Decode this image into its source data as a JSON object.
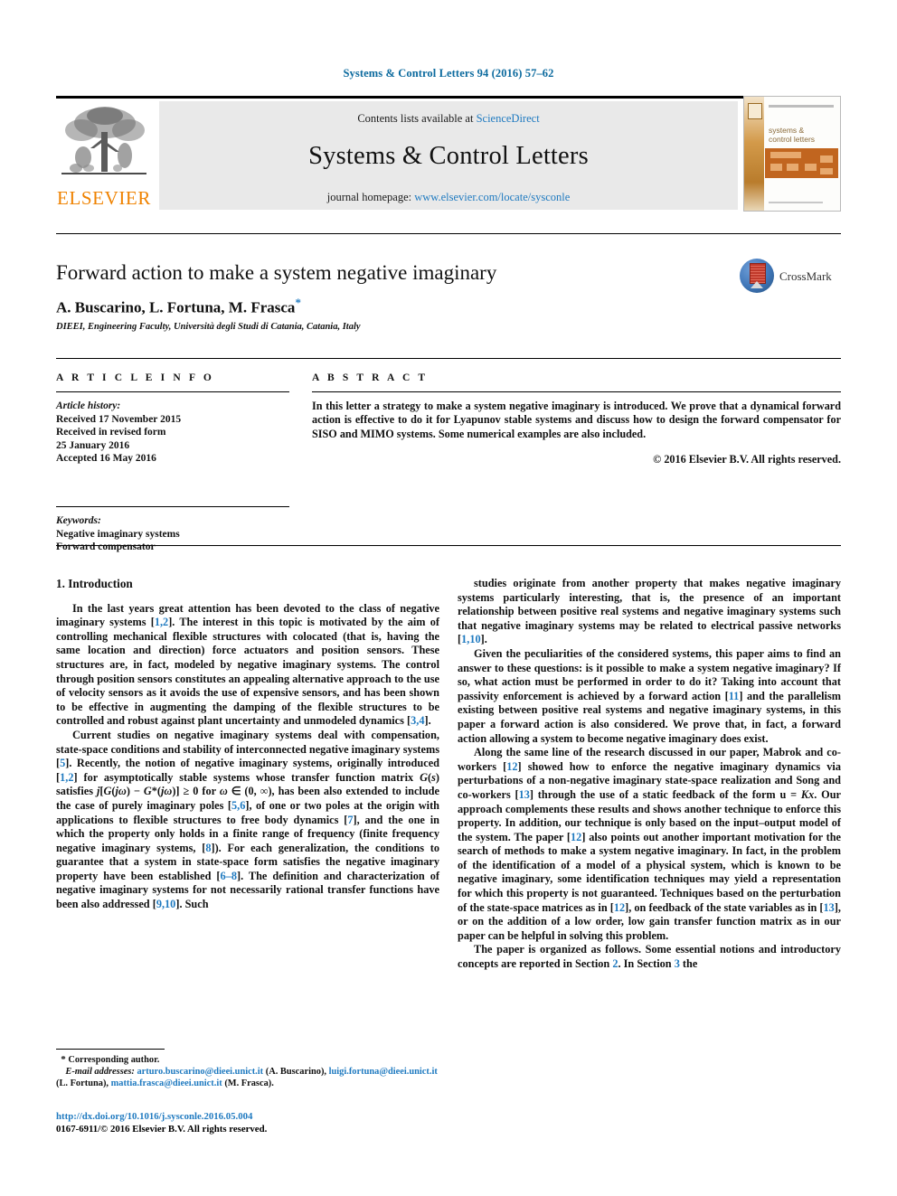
{
  "running_head": "Systems & Control Letters 94 (2016) 57–62",
  "masthead": {
    "contents_prefix": "Contents lists available at ",
    "sciencedirect": "ScienceDirect",
    "journal_title": "Systems & Control Letters",
    "homepage_prefix": "journal homepage: ",
    "homepage_url": "www.elsevier.com/locate/sysconle",
    "publisher_wordmark": "ELSEVIER",
    "cover_title_line1": "systems &",
    "cover_title_line2": "control letters"
  },
  "article": {
    "title": "Forward action to make a system negative imaginary",
    "authors": "A. Buscarino, L. Fortuna, M. Frasca",
    "corresponding_marker": "*",
    "affiliation": "DIEEI, Engineering Faculty, Università degli Studi di Catania, Catania, Italy"
  },
  "crossmark": {
    "label": "CrossMark"
  },
  "info": {
    "heading": "A R T I C L E   I N F O",
    "history_label": "Article history:",
    "history_lines": [
      "Received 17 November 2015",
      "Received in revised form",
      "25 January 2016",
      "Accepted 16 May 2016"
    ],
    "keywords_label": "Keywords:",
    "keywords": [
      "Negative imaginary systems",
      "Forward compensator"
    ]
  },
  "abstract": {
    "heading": "A B S T R A C T",
    "text": "In this letter a strategy to make a system negative imaginary is introduced. We prove that a dynamical forward action is effective to do it for Lyapunov stable systems and discuss how to design the forward compensator for SISO and MIMO systems. Some numerical examples are also included.",
    "copyright": "© 2016 Elsevier B.V. All rights reserved."
  },
  "body": {
    "section_title": "1. Introduction",
    "left_paragraphs": [
      "In the last years great attention has been devoted to the class of negative imaginary systems [1,2]. The interest in this topic is motivated by the aim of controlling mechanical flexible structures with colocated (that is, having the same location and direction) force actuators and position sensors. These structures are, in fact, modeled by negative imaginary systems. The control through position sensors constitutes an appealing alternative approach to the use of velocity sensors as it avoids the use of expensive sensors, and has been shown to be effective in augmenting the damping of the flexible structures to be controlled and robust against plant uncertainty and unmodeled dynamics [3,4].",
      "Current studies on negative imaginary systems deal with compensation, state-space conditions and stability of interconnected negative imaginary systems [5]. Recently, the notion of negative imaginary systems, originally introduced [1,2] for asymptotically stable systems whose transfer function matrix G(s) satisfies j[G(jω) − G*(jω)] ≥ 0 for ω ∈ (0, ∞), has been also extended to include the case of purely imaginary poles [5,6], of one or two poles at the origin with applications to flexible structures to free body dynamics [7], and the one in which the property only holds in a finite range of frequency (finite frequency negative imaginary systems, [8]). For each generalization, the conditions to guarantee that a system in state-space form satisfies the negative imaginary property have been established [6–8]. The definition and characterization of negative imaginary systems for not necessarily rational transfer functions have been also addressed [9,10]. Such"
    ],
    "right_paragraphs": [
      "studies originate from another property that makes negative imaginary systems particularly interesting, that is, the presence of an important relationship between positive real systems and negative imaginary systems such that negative imaginary systems may be related to electrical passive networks [1,10].",
      "Given the peculiarities of the considered systems, this paper aims to find an answer to these questions: is it possible to make a system negative imaginary? If so, what action must be performed in order to do it? Taking into account that passivity enforcement is achieved by a forward action [11] and the parallelism existing between positive real systems and negative imaginary systems, in this paper a forward action is also considered. We prove that, in fact, a forward action allowing a system to become negative imaginary does exist.",
      "Along the same line of the research discussed in our paper, Mabrok and co-workers [12] showed how to enforce the negative imaginary dynamics via perturbations of a non-negative imaginary state-space realization and Song and co-workers [13] through the use of a static feedback of the form u = Kx. Our approach complements these results and shows another technique to enforce this property. In addition, our technique is only based on the input–output model of the system. The paper [12] also points out another important motivation for the search of methods to make a system negative imaginary. In fact, in the problem of the identification of a model of a physical system, which is known to be negative imaginary, some identification techniques may yield a representation for which this property is not guaranteed. Techniques based on the perturbation of the state-space matrices as in [12], on feedback of the state variables as in [13], or on the addition of a low order, low gain transfer function matrix as in our paper can be helpful in solving this problem.",
      "The paper is organized as follows. Some essential notions and introductory concepts are reported in Section 2. In Section 3 the"
    ]
  },
  "footnote": {
    "corresponding_marker": "*",
    "corresponding_text": "Corresponding author.",
    "email_label": "E-mail addresses:",
    "emails": [
      {
        "address": "arturo.buscarino@dieei.unict.it",
        "owner": "(A. Buscarino)"
      },
      {
        "address": "luigi.fortuna@dieei.unict.it",
        "owner": "(L. Fortuna)"
      },
      {
        "address": "mattia.frasca@dieei.unict.it",
        "owner": "(M. Frasca)"
      }
    ],
    "doi": "http://dx.doi.org/10.1016/j.sysconle.2016.05.004",
    "issn_line": "0167-6911/© 2016 Elsevier B.V. All rights reserved."
  },
  "colors": {
    "link": "#1f7ac0",
    "elsevier_orange": "#ef8200",
    "band_gray": "#e9e9e9"
  }
}
